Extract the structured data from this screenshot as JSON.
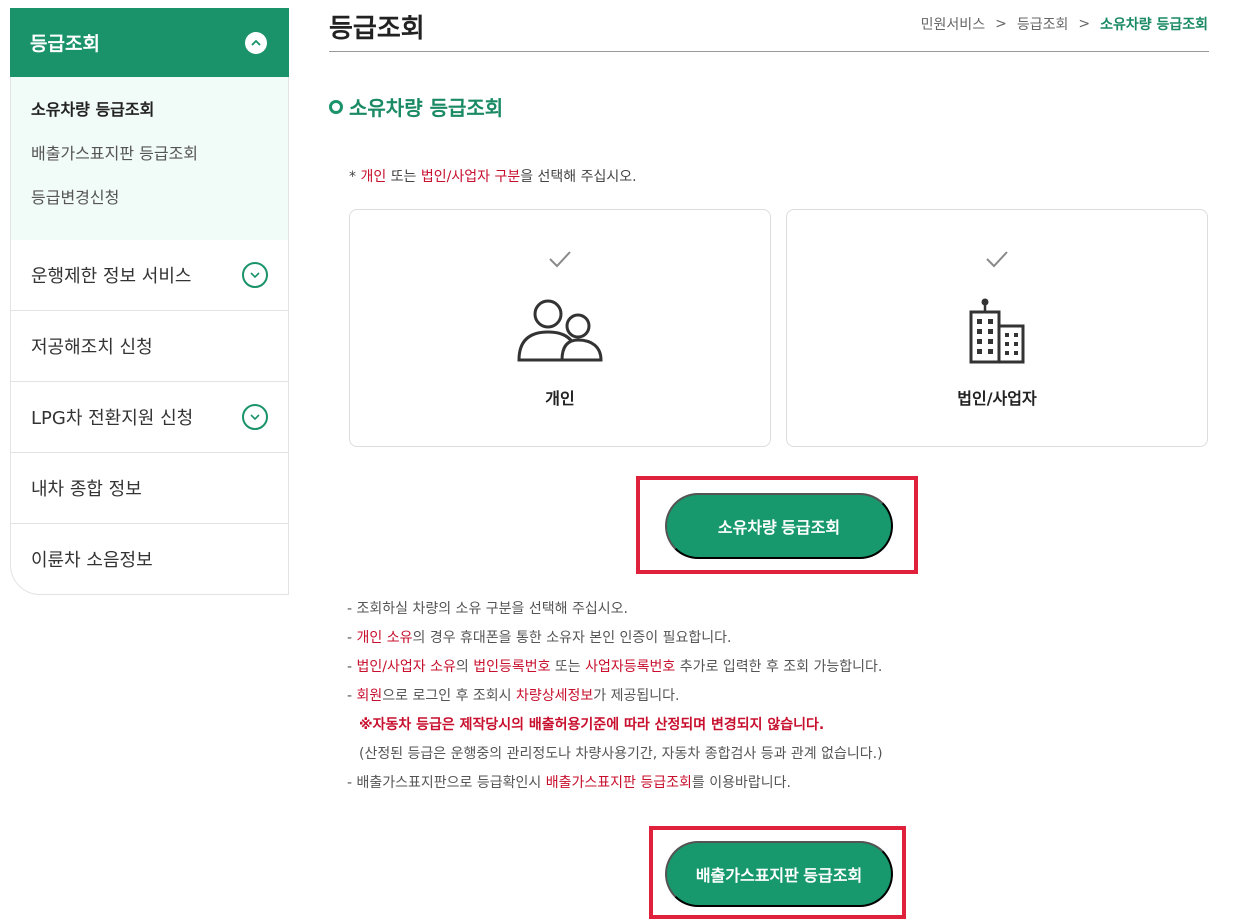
{
  "sidebar": {
    "header": "등급조회",
    "sub_items": [
      "소유차량 등급조회",
      "배출가스표지판 등급조회",
      "등급변경신청"
    ],
    "items": [
      {
        "label": "운행제한 정보 서비스"
      },
      {
        "label": "저공해조치 신청"
      },
      {
        "label": "LPG차 전환지원 신청"
      },
      {
        "label": "내차 종합 정보"
      },
      {
        "label": "이륜차 소음정보"
      }
    ]
  },
  "header": {
    "title": "등급조회",
    "breadcrumb": [
      "민원서비스",
      "등급조회",
      "소유차량 등급조회"
    ],
    "separator": ">"
  },
  "section": {
    "title": "소유차량 등급조회",
    "instruction": {
      "prefix": "* ",
      "individual": "개인",
      "or": " 또는 ",
      "corporate": "법인/사업자 구분",
      "suffix": "을 선택해 주십시오."
    }
  },
  "cards": {
    "individual": "개인",
    "corporate": "법인/사업자"
  },
  "buttons": {
    "vehicle_grade": "소유차량 등급조회",
    "plate_grade": "배출가스표지판 등급조회"
  },
  "notes": {
    "n1": "- 조회하실 차량의 소유 구분을 선택해 주십시오.",
    "n2_dash": "- ",
    "n2_red": "개인 소유",
    "n2_rest": "의 경우 휴대폰을 통한 소유자 본인 인증이 필요합니다.",
    "n3_dash": "- ",
    "n3_red1": "법인/사업자 소유",
    "n3_mid1": "의 ",
    "n3_red2": "법인등록번호",
    "n3_mid2": " 또는 ",
    "n3_red3": "사업자등록번호",
    "n3_rest": " 추가로 입력한 후 조회 가능합니다.",
    "n4_dash": "- ",
    "n4_red1": "회원",
    "n4_mid": "으로 로그인 후 조회시 ",
    "n4_red2": "차량상세정보",
    "n4_rest": "가 제공됩니다.",
    "n5": "※자동차 등급은 제작당시의 배출허용기준에 따라 산정되며 변경되지 않습니다.",
    "n6": "(산정된 등급은 운행중의 관리정도나 차량사용기간, 자동차 종합검사 등과 관계 없습니다.)",
    "n7_prefix": "- 배출가스표지판으로 등급확인시 ",
    "n7_red": "배출가스표지판 등급조회",
    "n7_rest": "를 이용바랍니다."
  },
  "colors": {
    "brand_green": "#1a936a",
    "highlight_red": "#e0213b",
    "text_red": "#c8102e"
  }
}
